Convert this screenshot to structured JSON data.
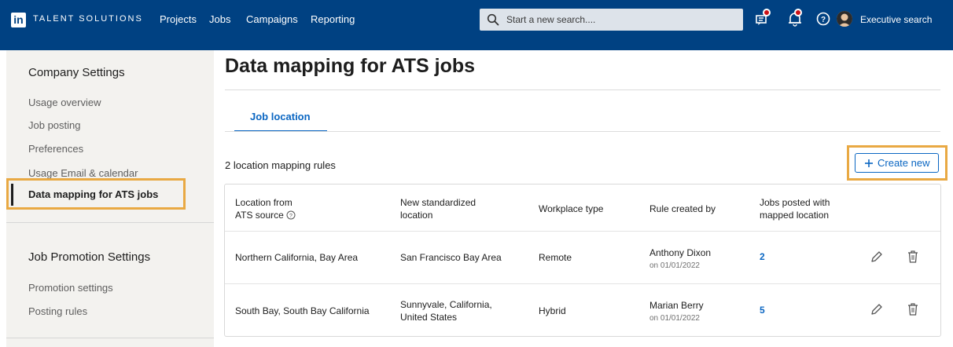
{
  "brand": {
    "logo": "in",
    "text": "TALENT SOLUTIONS"
  },
  "nav": {
    "items": [
      "Projects",
      "Jobs",
      "Campaigns",
      "Reporting"
    ]
  },
  "search": {
    "placeholder": "Start a new search...."
  },
  "user": {
    "name": "Executive search"
  },
  "sidebar": {
    "company_heading": "Company Settings",
    "company_items": [
      "Usage overview",
      "Job posting",
      "Preferences",
      "Usage Email & calendar"
    ],
    "active_item": "Data mapping for ATS jobs",
    "promo_heading": "Job Promotion Settings",
    "promo_items": [
      "Promotion settings",
      "Posting rules"
    ]
  },
  "main": {
    "title": "Data mapping for ATS jobs",
    "tab": "Job location",
    "rule_count": "2 location mapping rules",
    "create_label": "Create new"
  },
  "table": {
    "headers": {
      "source_1": "Location from",
      "source_2": "ATS source",
      "std_1": "New standardized",
      "std_2": "location",
      "workplace": "Workplace type",
      "created": "Rule created by",
      "jobs_1": "Jobs posted with",
      "jobs_2": "mapped location"
    },
    "rows": [
      {
        "source": "Northern California, Bay Area",
        "std_1": "San Francisco Bay Area",
        "std_2": "",
        "workplace": "Remote",
        "creator": "Anthony Dixon",
        "date": "on 01/01/2022",
        "jobs": "2"
      },
      {
        "source": "South Bay, South Bay California",
        "std_1": "Sunnyvale, California,",
        "std_2": "United States",
        "workplace": "Hybrid",
        "creator": "Marian Berry",
        "date": "on 01/01/2022",
        "jobs": "5"
      }
    ]
  },
  "colors": {
    "topbar": "#004182",
    "accent": "#0a66c2",
    "highlight": "#e9a943",
    "notification": "#cc1016"
  }
}
